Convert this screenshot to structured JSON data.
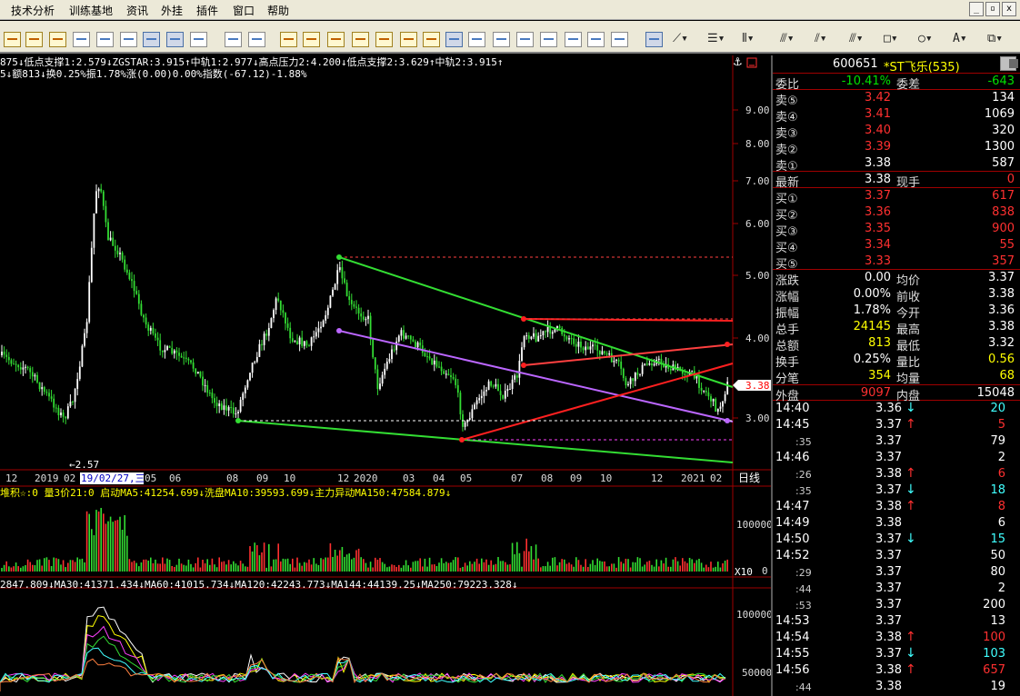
{
  "menu": {
    "items": [
      "技术分析",
      "训练基地",
      "资讯",
      "外挂",
      "插件",
      "窗口",
      "帮助"
    ],
    "window_buttons": [
      "_",
      "▫",
      "x"
    ]
  },
  "chart": {
    "indicator_line1": "875↓低点支撑1:2.579↓ZGSTAR:3.915↑中轨1:2.977↓高点压力2:4.200↓低点支撑2:3.629↑中轨2:3.915↑",
    "indicator_line2": "5↓额813↓换0.25%振1.78%涨(0.00)0.00%指数(-67.12)-1.88%",
    "price_axis": [
      "9.00",
      "8.00",
      "7.00",
      "6.00",
      "5.00",
      "4.00",
      "3.00"
    ],
    "current_price_tag": "3.38",
    "low_label": "←2.57",
    "date_axis": [
      "12",
      "2019",
      "02",
      "19/02/27,三",
      "05",
      "06",
      "08",
      "09",
      "10",
      "12",
      "2020",
      "03",
      "04",
      "05",
      "07",
      "08",
      "09",
      "10",
      "12",
      "2021",
      "02"
    ],
    "period_label": "日线",
    "volume_legend": "堆积☆:0 量3价21:0 启动MA5:41254.699↓洗盘MA10:39593.699↓主力异动MA150:47584.879↓",
    "volume_axis": [
      "100000",
      "50000",
      "0"
    ],
    "volume_unit": "X10",
    "ma_legend": "2847.809↓MA30:41371.434↓MA60:41015.734↓MA120:42243.773↓MA144:44139.25↓MA250:79223.328↓",
    "ma_axis": [
      "100000",
      "50000"
    ]
  },
  "quote": {
    "code": "600651",
    "name": "*ST飞乐(535)",
    "weibi_label": "委比",
    "weibi": "-10.41%",
    "weicha_label": "委差",
    "weicha": "-643",
    "asks": [
      {
        "label": "卖⑤",
        "price": "3.42",
        "vol": "134"
      },
      {
        "label": "卖④",
        "price": "3.41",
        "vol": "1069"
      },
      {
        "label": "卖③",
        "price": "3.40",
        "vol": "320"
      },
      {
        "label": "卖②",
        "price": "3.39",
        "vol": "1300"
      },
      {
        "label": "卖①",
        "price": "3.38",
        "vol": "587"
      }
    ],
    "last_label": "最新",
    "last": "3.38",
    "xianshou_label": "现手",
    "xianshou": "0",
    "bids": [
      {
        "label": "买①",
        "price": "3.37",
        "vol": "617"
      },
      {
        "label": "买②",
        "price": "3.36",
        "vol": "838"
      },
      {
        "label": "买③",
        "price": "3.35",
        "vol": "900"
      },
      {
        "label": "买④",
        "price": "3.34",
        "vol": "55"
      },
      {
        "label": "买⑤",
        "price": "3.33",
        "vol": "357"
      }
    ],
    "stats": [
      {
        "l1": "涨跌",
        "v1": "0.00",
        "l2": "均价",
        "v2": "3.37"
      },
      {
        "l1": "涨幅",
        "v1": "0.00%",
        "l2": "前收",
        "v2": "3.38"
      },
      {
        "l1": "振幅",
        "v1": "1.78%",
        "l2": "今开",
        "v2": "3.36"
      },
      {
        "l1": "总手",
        "v1": "24145",
        "l2": "最高",
        "v2": "3.38"
      },
      {
        "l1": "总额",
        "v1": "813",
        "l2": "最低",
        "v2": "3.32"
      },
      {
        "l1": "换手",
        "v1": "0.25%",
        "l2": "量比",
        "v2": "0.56"
      },
      {
        "l1": "分笔",
        "v1": "354",
        "l2": "均量",
        "v2": "68"
      }
    ],
    "waipan_label": "外盘",
    "waipan": "9097",
    "neipan_label": "内盘",
    "neipan": "15048",
    "ticks": [
      {
        "time": "14:40",
        "sub": false,
        "price": "3.36",
        "dir": "down",
        "vol": "20"
      },
      {
        "time": "14:45",
        "sub": false,
        "price": "3.37",
        "dir": "up",
        "vol": "5"
      },
      {
        "time": ":35",
        "sub": true,
        "price": "3.37",
        "dir": "",
        "vol": "79"
      },
      {
        "time": "14:46",
        "sub": false,
        "price": "3.37",
        "dir": "",
        "vol": "2"
      },
      {
        "time": ":26",
        "sub": true,
        "price": "3.38",
        "dir": "up",
        "vol": "6"
      },
      {
        "time": ":35",
        "sub": true,
        "price": "3.37",
        "dir": "down",
        "vol": "18"
      },
      {
        "time": "14:47",
        "sub": false,
        "price": "3.38",
        "dir": "up",
        "vol": "8"
      },
      {
        "time": "14:49",
        "sub": false,
        "price": "3.38",
        "dir": "",
        "vol": "6"
      },
      {
        "time": "14:50",
        "sub": false,
        "price": "3.37",
        "dir": "down",
        "vol": "15"
      },
      {
        "time": "14:52",
        "sub": false,
        "price": "3.37",
        "dir": "",
        "vol": "50"
      },
      {
        "time": ":29",
        "sub": true,
        "price": "3.37",
        "dir": "",
        "vol": "80"
      },
      {
        "time": ":44",
        "sub": true,
        "price": "3.37",
        "dir": "",
        "vol": "2"
      },
      {
        "time": ":53",
        "sub": true,
        "price": "3.37",
        "dir": "",
        "vol": "200"
      },
      {
        "time": "14:53",
        "sub": false,
        "price": "3.37",
        "dir": "",
        "vol": "13"
      },
      {
        "time": "14:54",
        "sub": false,
        "price": "3.38",
        "dir": "up",
        "vol": "100"
      },
      {
        "time": "14:55",
        "sub": false,
        "price": "3.37",
        "dir": "down",
        "vol": "103"
      },
      {
        "time": "14:56",
        "sub": false,
        "price": "3.38",
        "dir": "up",
        "vol": "657"
      },
      {
        "time": ":44",
        "sub": true,
        "price": "3.38",
        "dir": "",
        "vol": "19"
      }
    ]
  }
}
